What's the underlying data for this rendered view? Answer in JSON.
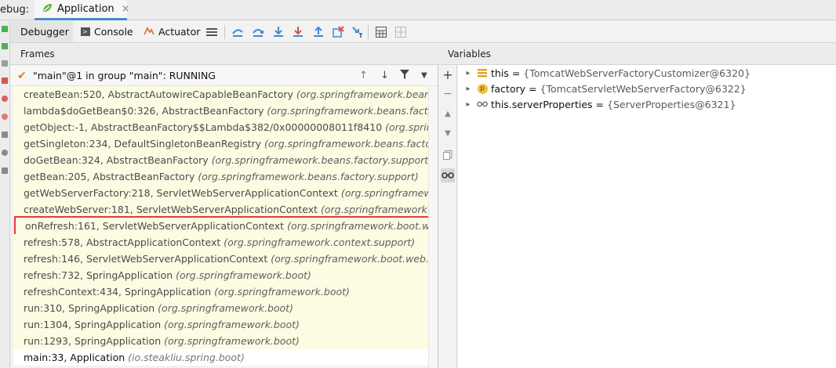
{
  "window": {
    "debug_label": "ebug:",
    "tab_title": "Application",
    "tab_close": "×"
  },
  "toolbar": {
    "debugger_label": "Debugger",
    "console_label": "Console",
    "actuator_label": "Actuator",
    "icons": [
      "layout-icon",
      "show-execution-point-icon",
      "step-over-icon",
      "step-into-icon",
      "force-step-into-icon",
      "step-out-icon",
      "drop-frame-icon",
      "run-to-cursor-icon",
      "evaluate-expression-icon",
      "trace-icon"
    ]
  },
  "frames": {
    "header": "Frames",
    "thread": "\"main\"@1 in group \"main\": RUNNING",
    "items": [
      {
        "method": "createBean:520, AbstractAutowireCapableBeanFactory",
        "pkg": "(org.springframework.beans.factory"
      },
      {
        "method": "lambda$doGetBean$0:326, AbstractBeanFactory",
        "pkg": "(org.springframework.beans.factory.suppo"
      },
      {
        "method": "getObject:-1, AbstractBeanFactory$$Lambda$382/0x00000008011f8410",
        "pkg": "(org.springframewo"
      },
      {
        "method": "getSingleton:234, DefaultSingletonBeanRegistry",
        "pkg": "(org.springframework.beans.factory.suppo"
      },
      {
        "method": "doGetBean:324, AbstractBeanFactory",
        "pkg": "(org.springframework.beans.factory.support)"
      },
      {
        "method": "getBean:205, AbstractBeanFactory",
        "pkg": "(org.springframework.beans.factory.support)"
      },
      {
        "method": "getWebServerFactory:218, ServletWebServerApplicationContext",
        "pkg": "(org.springframework.boo"
      },
      {
        "method": "createWebServer:181, ServletWebServerApplicationContext",
        "pkg": "(org.springframework.boot.we"
      },
      {
        "method": "onRefresh:161, ServletWebServerApplicationContext",
        "pkg": "(org.springframework.boot.web.servle"
      },
      {
        "method": "refresh:578, AbstractApplicationContext",
        "pkg": "(org.springframework.context.support)"
      },
      {
        "method": "refresh:146, ServletWebServerApplicationContext",
        "pkg": "(org.springframework.boot.web.servlet.c"
      },
      {
        "method": "refresh:732, SpringApplication",
        "pkg": "(org.springframework.boot)"
      },
      {
        "method": "refreshContext:434, SpringApplication",
        "pkg": "(org.springframework.boot)"
      },
      {
        "method": "run:310, SpringApplication",
        "pkg": "(org.springframework.boot)"
      },
      {
        "method": "run:1304, SpringApplication",
        "pkg": "(org.springframework.boot)"
      },
      {
        "method": "run:1293, SpringApplication",
        "pkg": "(org.springframework.boot)"
      },
      {
        "method": "main:33, Application",
        "pkg": "(io.steakliu.spring.boot)"
      }
    ]
  },
  "variables": {
    "header": "Variables",
    "items": [
      {
        "name": "this",
        "value": "{TomcatWebServerFactoryCustomizer@6320}",
        "icon": "object-icon"
      },
      {
        "name": "factory",
        "value": "{TomcatServletWebServerFactory@6322}",
        "icon": "parameter-icon",
        "icon_letter": "p"
      },
      {
        "name": "this.serverProperties",
        "value": "{ServerProperties@6321}",
        "icon": "watch-icon"
      }
    ]
  }
}
